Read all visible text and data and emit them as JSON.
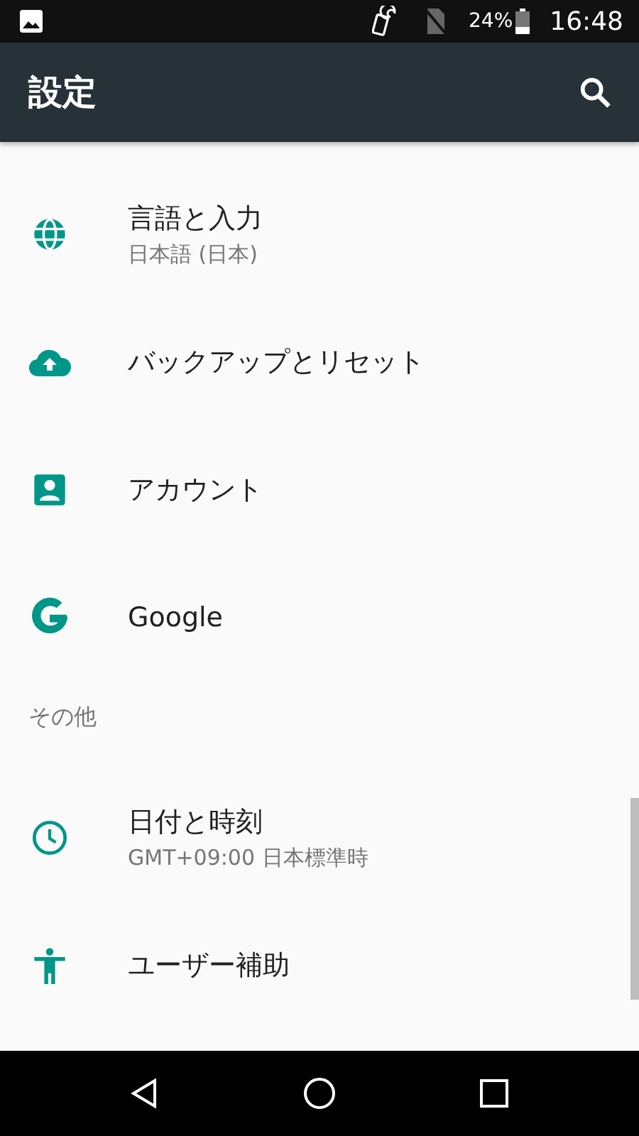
{
  "status_bar": {
    "battery": "24%",
    "time": "16:48"
  },
  "app_bar": {
    "title": "設定"
  },
  "items": [
    {
      "kind": "row",
      "title": "言語と入力",
      "subtitle": "日本語 (日本)"
    },
    {
      "kind": "row",
      "title": "バックアップとリセット"
    },
    {
      "kind": "row",
      "title": "アカウント"
    },
    {
      "kind": "row",
      "title": "Google"
    },
    {
      "kind": "header",
      "title": "その他"
    },
    {
      "kind": "row",
      "title": "日付と時刻",
      "subtitle": "GMT+09:00 日本標準時"
    },
    {
      "kind": "row",
      "title": "ユーザー補助"
    }
  ]
}
